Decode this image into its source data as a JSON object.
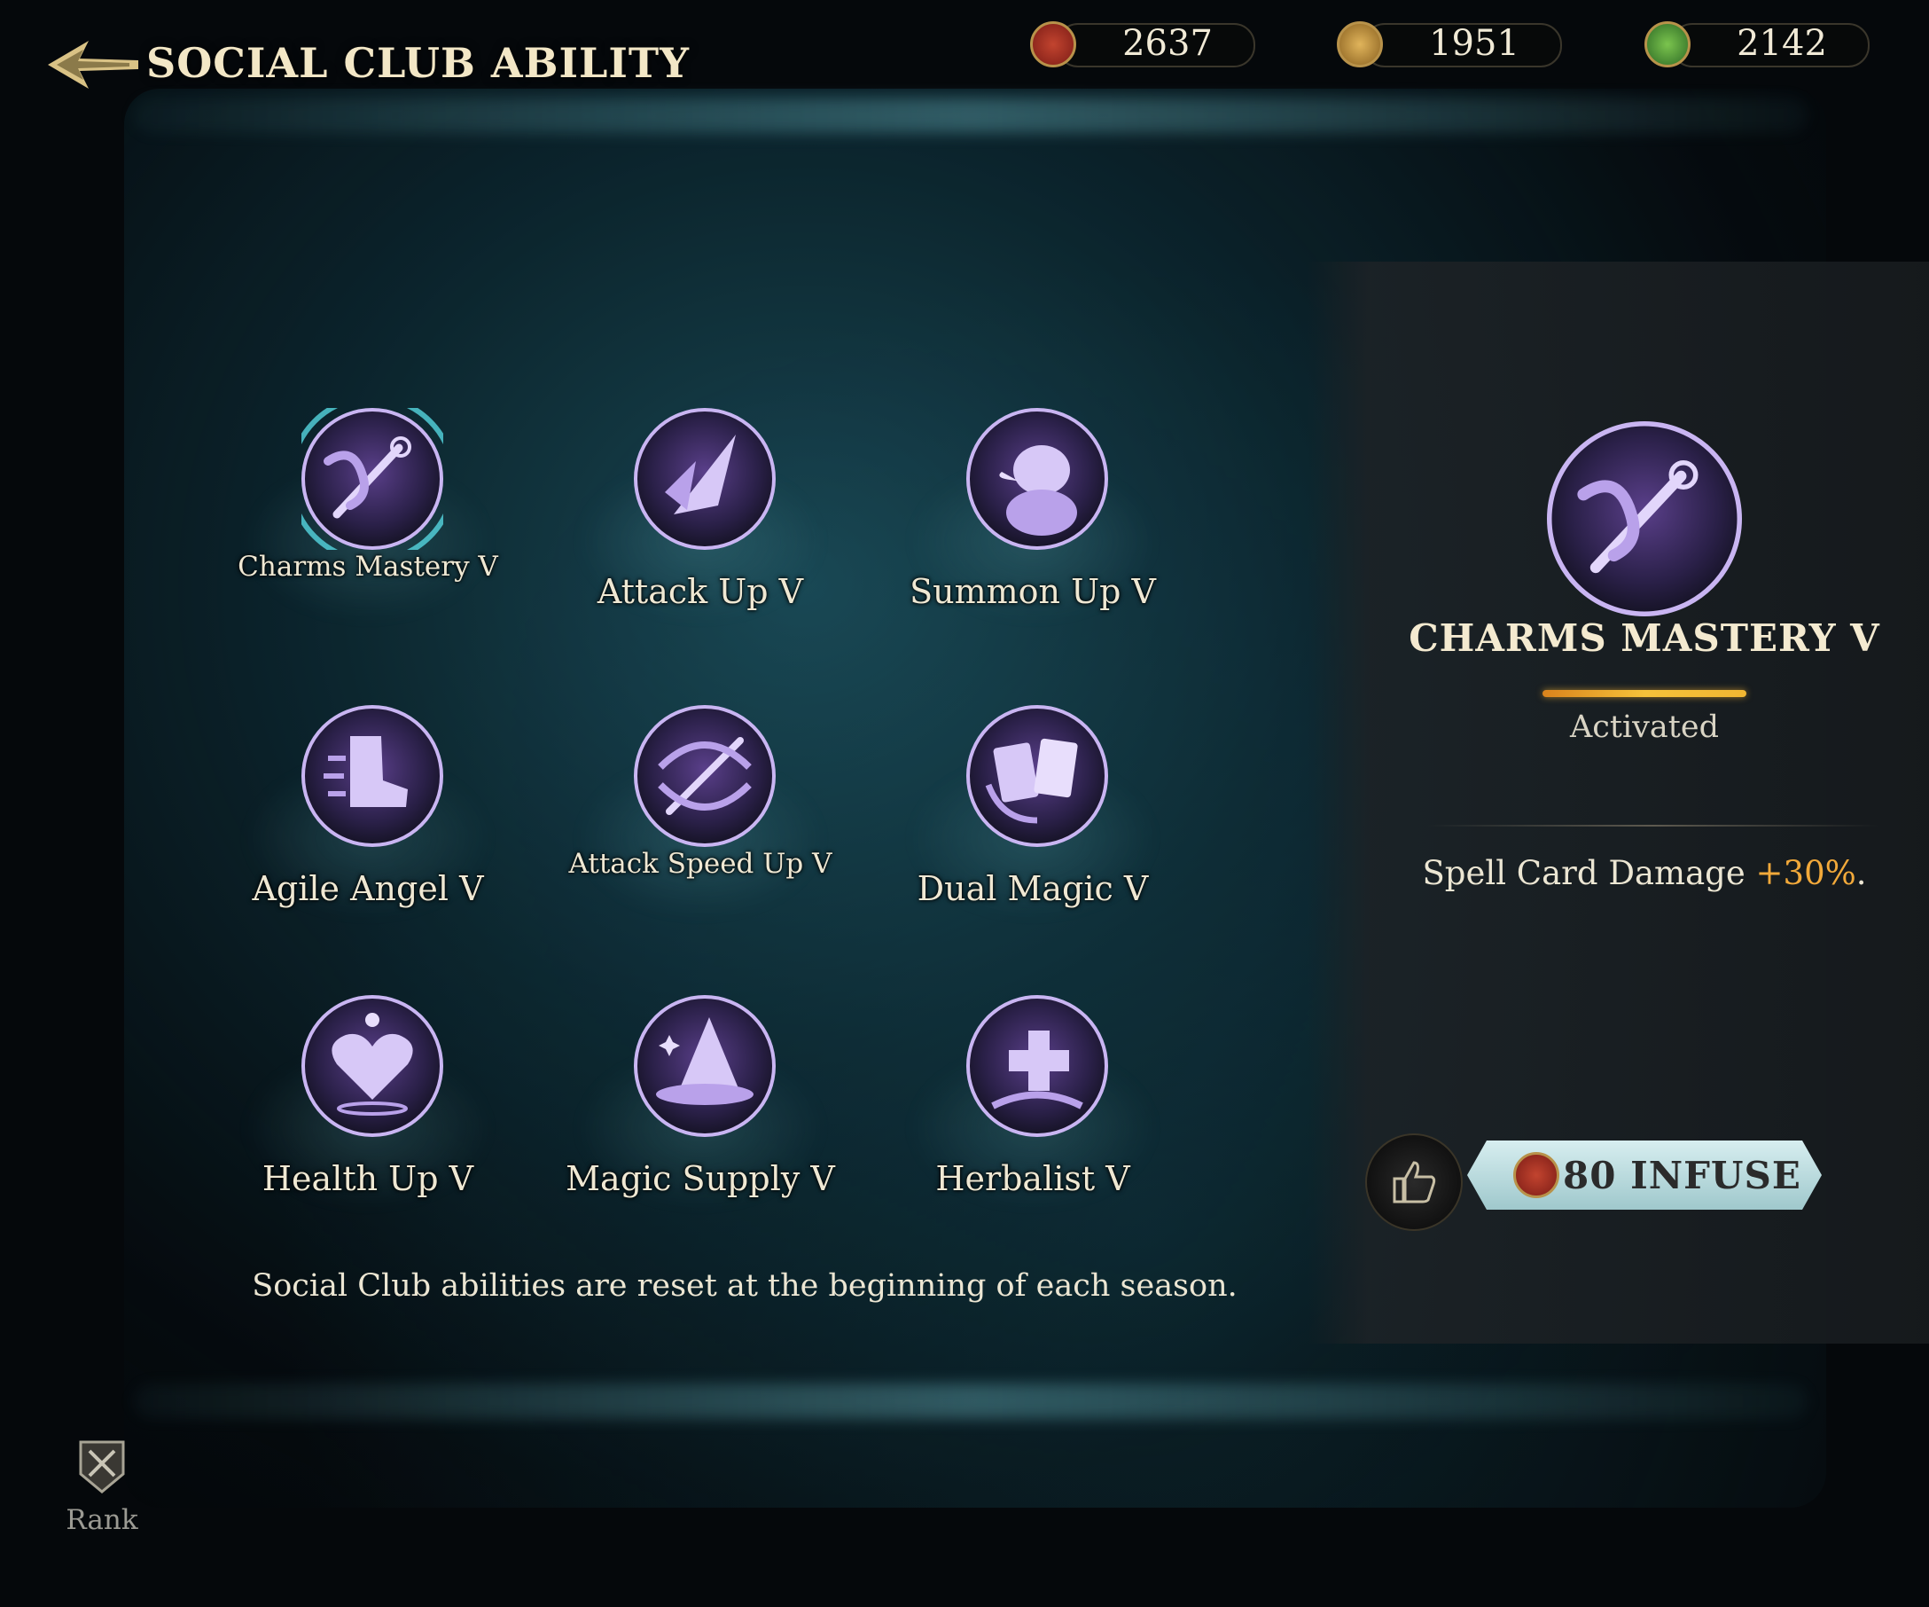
{
  "header": {
    "title": "SOCIAL CLUB ABILITY"
  },
  "currencies": [
    {
      "icon": "red-seal-coin-icon",
      "value": "2637",
      "color": "#9e2a22"
    },
    {
      "icon": "gold-feather-coin-icon",
      "value": "1951",
      "color": "#b7883a"
    },
    {
      "icon": "green-gem-coin-icon",
      "value": "2142",
      "color": "#3e8a3a"
    }
  ],
  "abilities": [
    {
      "label": "Charms Mastery V",
      "icon": "charms-wand-icon",
      "selected": true
    },
    {
      "label": "Attack Up V",
      "icon": "slash-strike-icon",
      "selected": false
    },
    {
      "label": "Summon Up V",
      "icon": "duck-creature-icon",
      "selected": false
    },
    {
      "label": "Agile Angel V",
      "icon": "boot-speed-icon",
      "selected": false
    },
    {
      "label": "Attack Speed Up V",
      "icon": "wand-swirl-icon",
      "selected": false
    },
    {
      "label": "Dual Magic V",
      "icon": "twin-cards-icon",
      "selected": false
    },
    {
      "label": "Health Up V",
      "icon": "heart-icon",
      "selected": false
    },
    {
      "label": "Magic Supply V",
      "icon": "wizard-hat-icon",
      "selected": false
    },
    {
      "label": "Herbalist V",
      "icon": "healing-cross-icon",
      "selected": false
    }
  ],
  "footnote": "Social Club abilities are reset at the beginning of each season.",
  "detail": {
    "title": "CHARMS MASTERY V",
    "status": "Activated",
    "desc_prefix": "Spell Card Damage ",
    "desc_value": "+30%",
    "desc_suffix": ".",
    "infuse_label": "80 INFUSE"
  },
  "nav": {
    "rank_label": "Rank"
  },
  "colors": {
    "accent_gold": "#f2a93a",
    "icon_purple": "#b9a1ea",
    "glow_teal": "#55d6e0"
  }
}
